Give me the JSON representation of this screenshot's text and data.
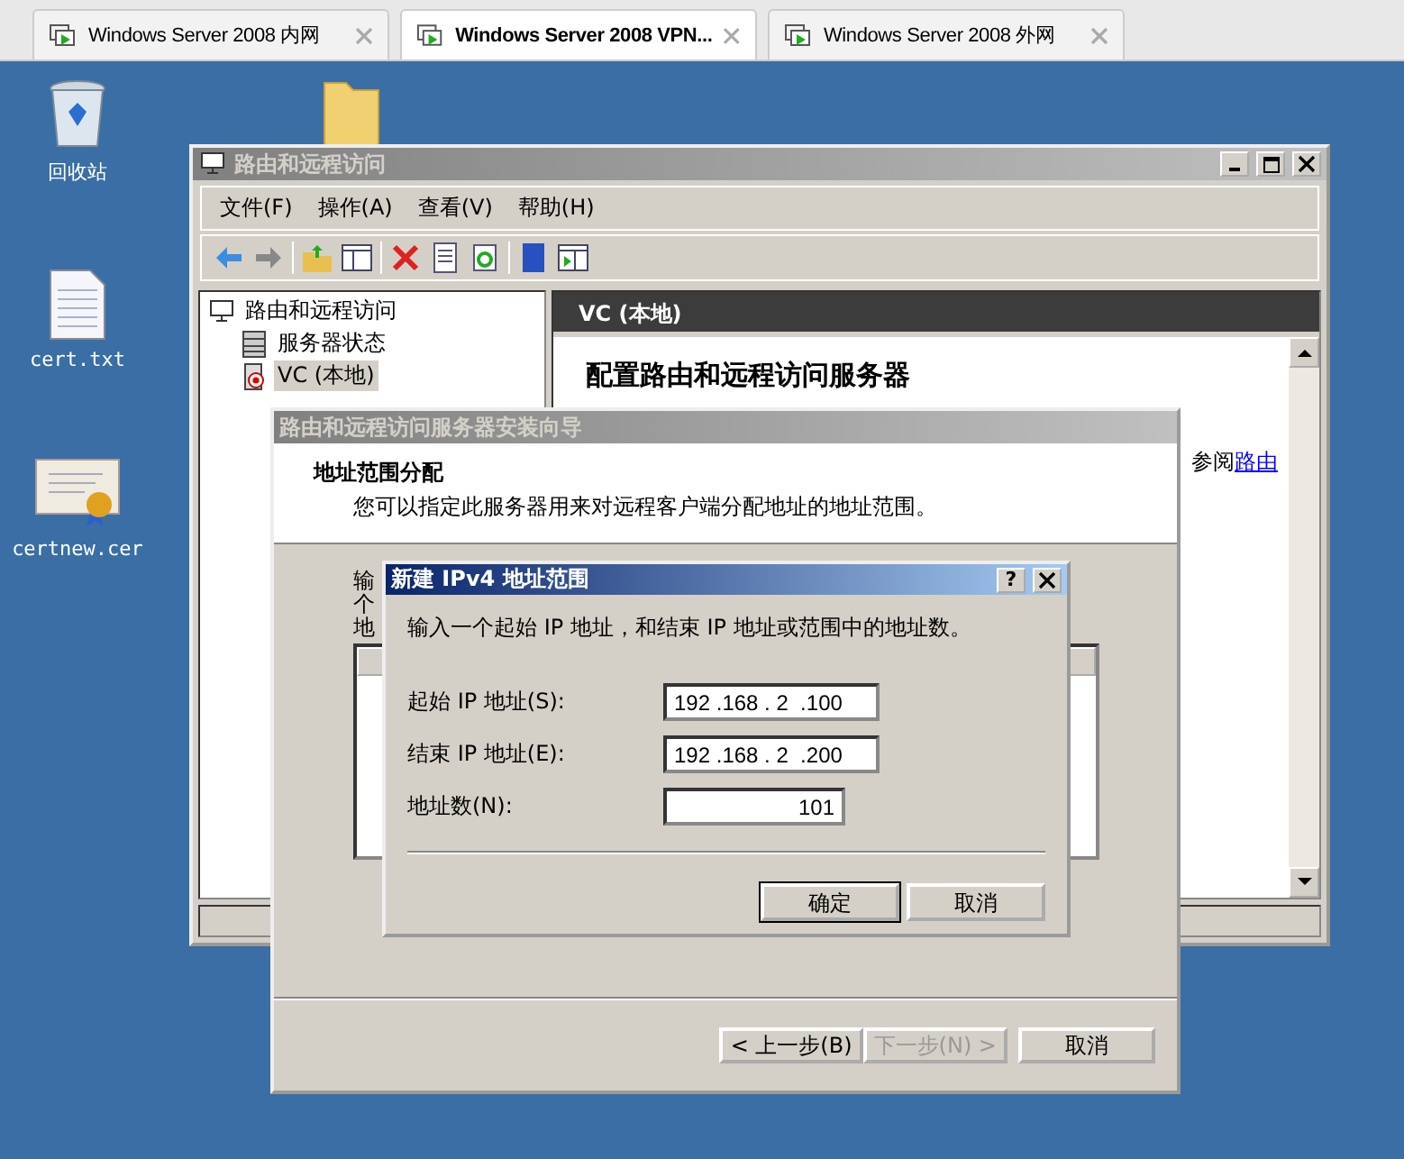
{
  "browser_tabs": [
    {
      "label": "Windows Server 2008 内网",
      "selected": false
    },
    {
      "label": "Windows Server 2008 VPN...",
      "selected": true
    },
    {
      "label": "Windows Server 2008 外网",
      "selected": false
    }
  ],
  "desktop_icons": [
    {
      "kind": "recycle",
      "label": "回收站"
    },
    {
      "kind": "text_file",
      "label": "cert.txt"
    },
    {
      "kind": "certificate",
      "label": "certnew.cer"
    }
  ],
  "main_window": {
    "title": "路由和远程访问",
    "menu": [
      "文件(F)",
      "操作(A)",
      "查看(V)",
      "帮助(H)"
    ],
    "tree": {
      "label": "路由和远程访问",
      "children": [
        {
          "label": "服务器状态",
          "kind": "status",
          "selected": false
        },
        {
          "label": "VC (本地)",
          "kind": "server",
          "selected": true
        }
      ]
    },
    "pane_header": "VC (本地)",
    "heading": "配置路由和远程访问服务器",
    "see_also": "参阅",
    "link": "路由"
  },
  "wizard": {
    "title": "路由和远程访问服务器安装向导",
    "header_title": "地址范围分配",
    "header_subtitle": "您可以指定此服务器用来对远程客户端分配地址的地址范围。",
    "fragments": [
      "输",
      "个",
      "地"
    ],
    "buttons": [
      {
        "label": "< 上一步(B)",
        "disabled": false
      },
      {
        "label": "下一步(N) >",
        "disabled": true
      },
      {
        "label": "取消",
        "disabled": false
      }
    ]
  },
  "dialog": {
    "title": "新建 IPv4 地址范围",
    "help": "?",
    "instruction": "输入一个起始 IP 地址，和结束 IP 地址或范围中的地址数。",
    "fields": [
      {
        "label": "起始 IP 地址(S):",
        "kind": "ip",
        "value": "192 .168 . 2  .100"
      },
      {
        "label": "结束 IP 地址(E):",
        "kind": "ip",
        "value": "192 .168 . 2  .200"
      },
      {
        "label": "地址数(N):",
        "kind": "number",
        "value": "101"
      }
    ],
    "buttons": [
      {
        "label": "确定",
        "default": true
      },
      {
        "label": "取消",
        "default": false
      }
    ]
  }
}
